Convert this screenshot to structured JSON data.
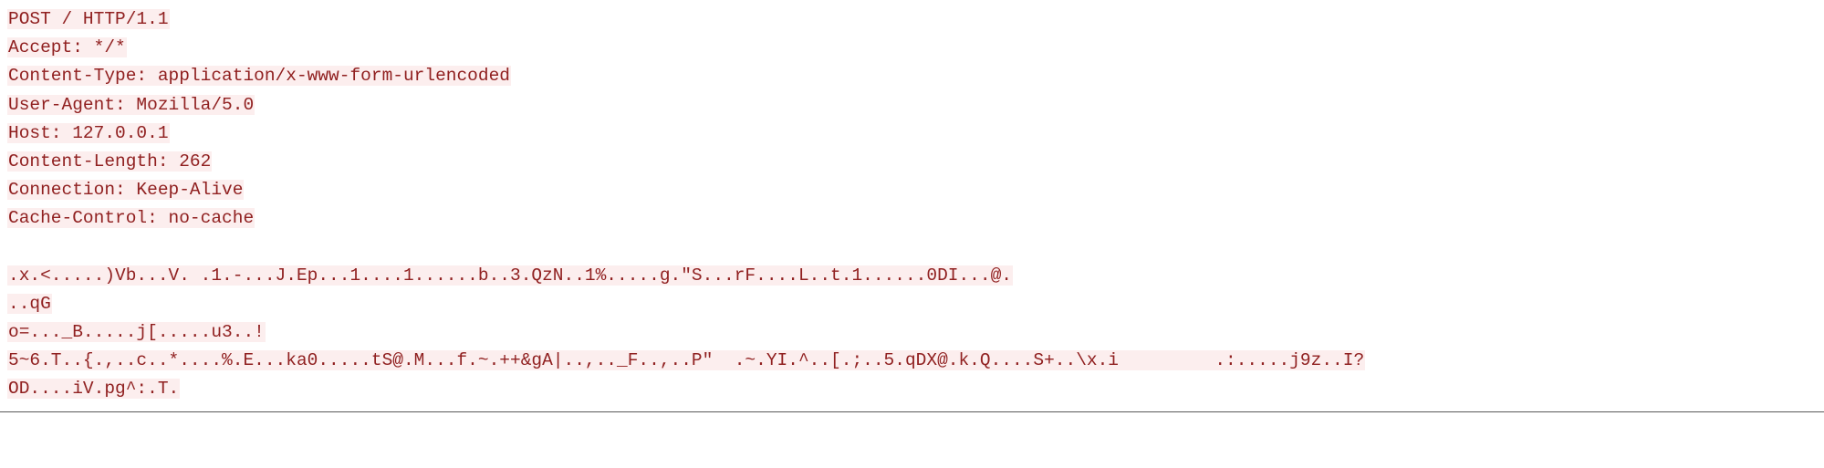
{
  "lines": [
    "POST / HTTP/1.1",
    "Accept: */*",
    "Content-Type: application/x-www-form-urlencoded",
    "User-Agent: Mozilla/5.0",
    "Host: 127.0.0.1",
    "Content-Length: 262",
    "Connection: Keep-Alive",
    "Cache-Control: no-cache"
  ],
  "body": [
    ".x.<.....)Vb...V. .1.-...J.Ep...1....1......b..3.QzN..1%.....g.\"S...rF....L..t.1......0DI...@.",
    "..qG",
    "o=..._B.....j[.....u3..!",
    "5~6.T..{.,..c..*....%.E...ka0.....tS@.M...f.~.++&gA|..,.._F..,..P\"  .~.YI.^..[.;..5.qDX@.k.Q....S+..\\x.i         .:.....j9z..I?",
    "OD....iV.pg^:.T."
  ]
}
